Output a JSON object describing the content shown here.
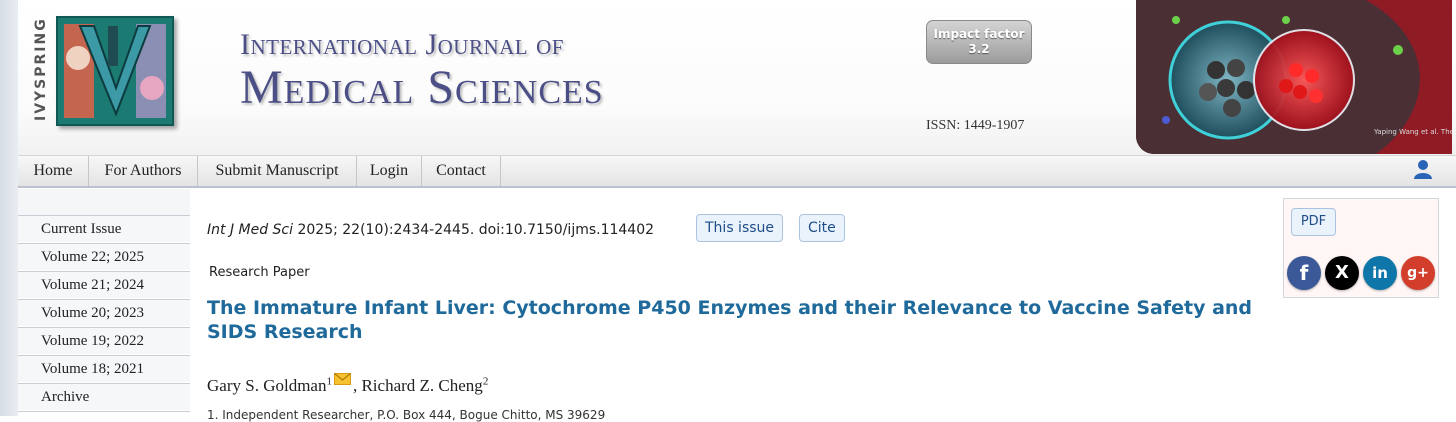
{
  "header": {
    "logo_text": "IVYSPRING",
    "journal_title_line1": "International Journal of",
    "journal_title_line2": "Medical Sciences",
    "impact_label": "Impact factor",
    "impact_value": "3.2",
    "issn": "ISSN: 1449-1907",
    "banner_caption": "Yaping Wang et al. Theranostics"
  },
  "nav": {
    "items": [
      "Home",
      "For Authors",
      "Submit Manuscript",
      "Login",
      "Contact"
    ],
    "user_icon": "user-icon"
  },
  "sidebar": {
    "items": [
      "Current Issue",
      "Volume 22; 2025",
      "Volume 21; 2024",
      "Volume 20; 2023",
      "Volume 19; 2022",
      "Volume 18; 2021",
      "Archive"
    ]
  },
  "article": {
    "journal_abbrev": "Int J Med Sci",
    "citation": " 2025; 22(10):2434-2445. doi:10.7150/ijms.114402",
    "this_issue_label": "This issue",
    "cite_label": "Cite",
    "paper_type": "Research Paper",
    "title": "The Immature Infant Liver: Cytochrome P450 Enzymes and their Relevance to Vaccine Safety and SIDS Research",
    "author1": "Gary S. Goldman",
    "author1_sup": "1",
    "author2": "Richard Z. Cheng",
    "author2_sup": "2",
    "separator": ", ",
    "affiliation": "1. Independent Researcher, P.O. Box 444, Bogue Chitto, MS 39629"
  },
  "share": {
    "pdf_label": "PDF",
    "icons": [
      "facebook-icon",
      "x-icon",
      "linkedin-icon",
      "google-plus-icon"
    ],
    "facebook": "f",
    "x": "X",
    "linkedin": "in",
    "googleplus": "g+",
    "colors": {
      "facebook": "#3b5998",
      "x": "#000000",
      "linkedin": "#0e76a8",
      "googleplus": "#d23e2b"
    }
  }
}
